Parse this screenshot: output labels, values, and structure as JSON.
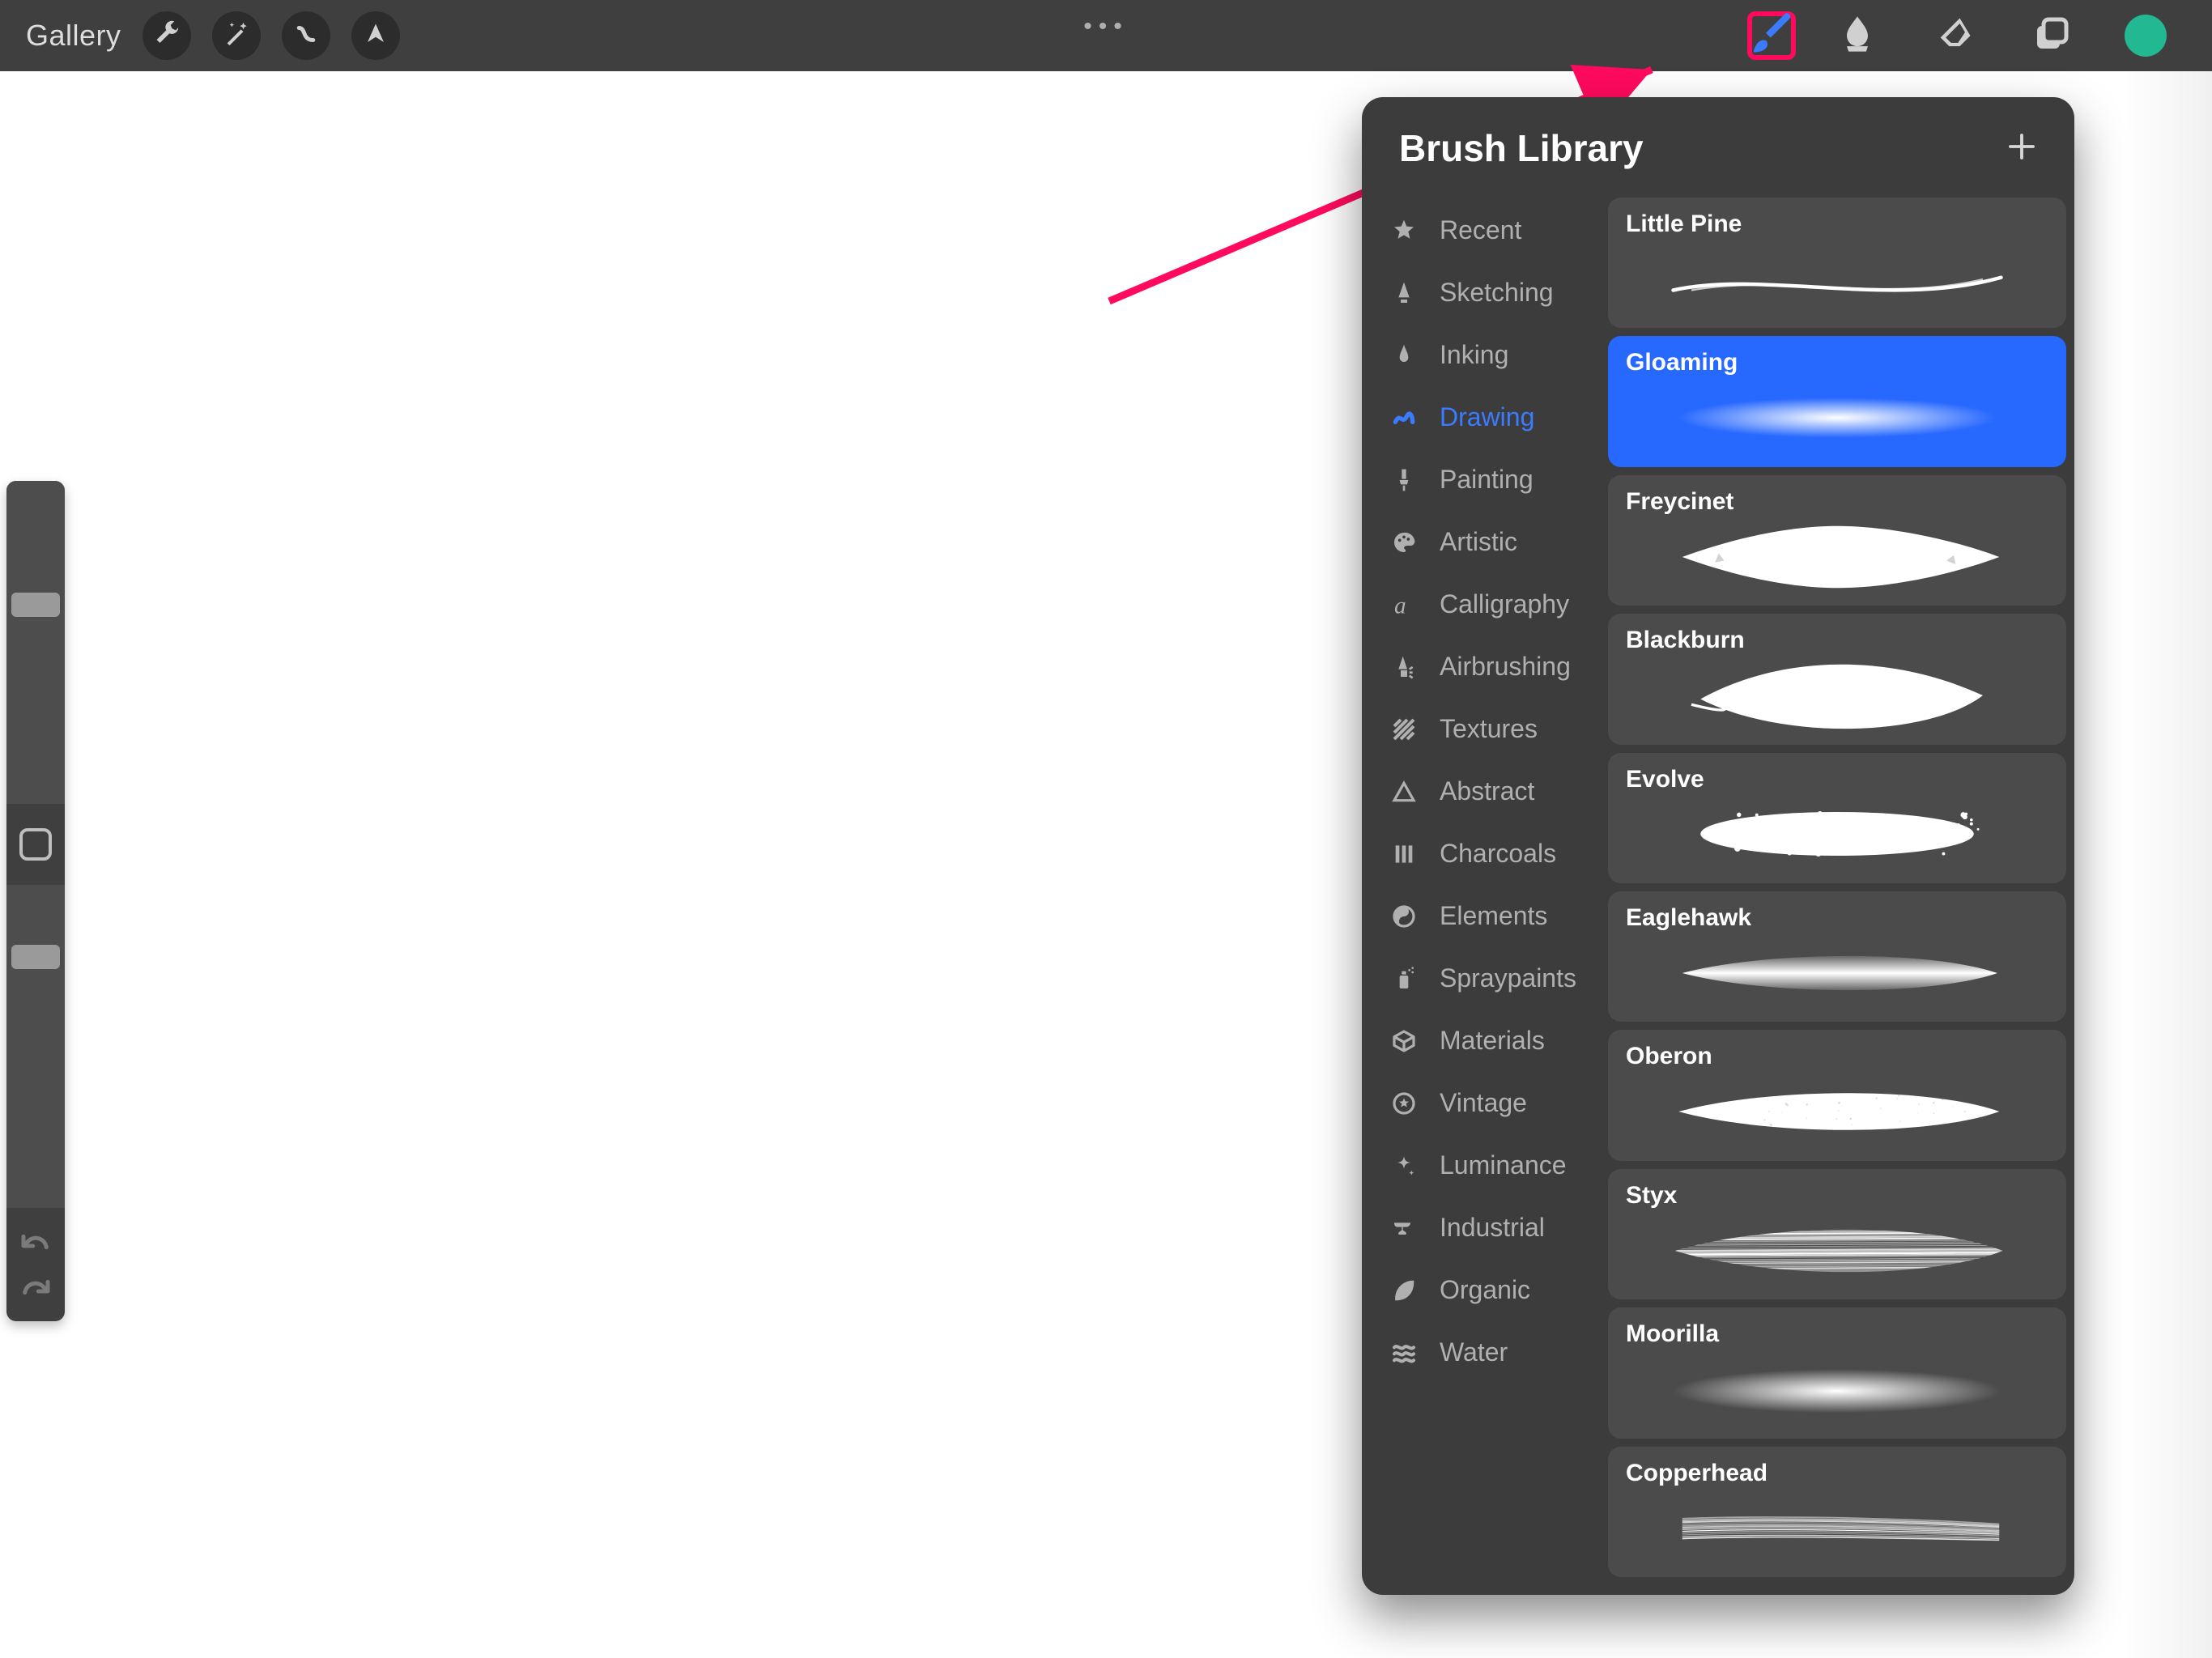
{
  "topbar": {
    "gallery": "Gallery"
  },
  "colors": {
    "accent_blue": "#2768ff",
    "highlight_pink": "#ff0a5e",
    "current_color": "#21b892"
  },
  "brush_panel": {
    "title": "Brush Library",
    "active_category_index": 3,
    "categories": [
      {
        "icon": "star-icon",
        "label": "Recent"
      },
      {
        "icon": "pencil-tip-icon",
        "label": "Sketching"
      },
      {
        "icon": "nib-icon",
        "label": "Inking"
      },
      {
        "icon": "scribble-icon",
        "label": "Drawing"
      },
      {
        "icon": "paint-brush-icon",
        "label": "Painting"
      },
      {
        "icon": "palette-icon",
        "label": "Artistic"
      },
      {
        "icon": "script-a-icon",
        "label": "Calligraphy"
      },
      {
        "icon": "airbrush-icon",
        "label": "Airbrushing"
      },
      {
        "icon": "hatch-icon",
        "label": "Textures"
      },
      {
        "icon": "triangle-icon",
        "label": "Abstract"
      },
      {
        "icon": "bars-icon",
        "label": "Charcoals"
      },
      {
        "icon": "yinyang-icon",
        "label": "Elements"
      },
      {
        "icon": "spray-can-icon",
        "label": "Spraypaints"
      },
      {
        "icon": "cube-icon",
        "label": "Materials"
      },
      {
        "icon": "star-circle-icon",
        "label": "Vintage"
      },
      {
        "icon": "sparkle-icon",
        "label": "Luminance"
      },
      {
        "icon": "anvil-icon",
        "label": "Industrial"
      },
      {
        "icon": "leaf-icon",
        "label": "Organic"
      },
      {
        "icon": "waves-icon",
        "label": "Water"
      }
    ],
    "selected_brush_index": 1,
    "brushes": [
      {
        "name": "Little Pine"
      },
      {
        "name": "Gloaming"
      },
      {
        "name": "Freycinet"
      },
      {
        "name": "Blackburn"
      },
      {
        "name": "Evolve"
      },
      {
        "name": "Eaglehawk"
      },
      {
        "name": "Oberon"
      },
      {
        "name": "Styx"
      },
      {
        "name": "Moorilla"
      },
      {
        "name": "Copperhead"
      }
    ]
  }
}
